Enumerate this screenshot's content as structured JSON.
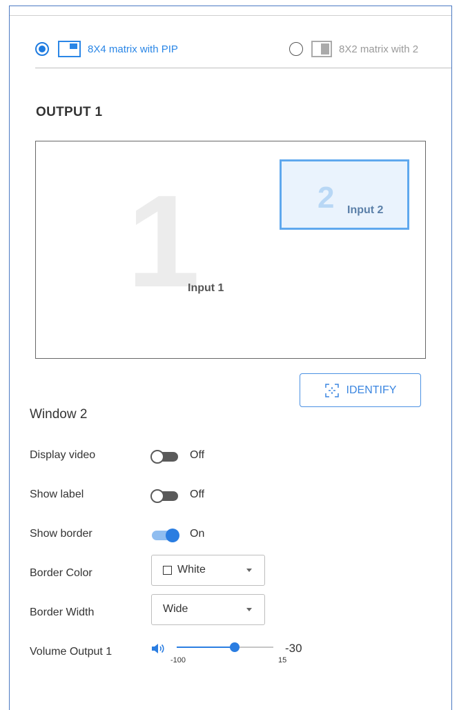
{
  "mode_options": [
    {
      "label": "8X4 matrix with PIP",
      "selected": true
    },
    {
      "label": "8X2 matrix with 2",
      "selected": false
    }
  ],
  "output": {
    "title": "OUTPUT 1",
    "main_window": {
      "number": "1",
      "label": "Input 1"
    },
    "pip_window": {
      "number": "2",
      "label": "Input 2"
    }
  },
  "identify_label": "IDENTIFY",
  "window_settings": {
    "title": "Window 2",
    "display_video": {
      "label": "Display video",
      "state": "Off"
    },
    "show_label": {
      "label": "Show label",
      "state": "Off"
    },
    "show_border": {
      "label": "Show border",
      "state": "On"
    },
    "border_color": {
      "label": "Border Color",
      "value": "White",
      "swatch": "#ffffff"
    },
    "border_width": {
      "label": "Border Width",
      "value": "Wide"
    },
    "volume": {
      "label": "Volume Output 1",
      "min": "-100",
      "max": "15",
      "value": "-30",
      "fraction": 0.6
    }
  },
  "colors": {
    "accent": "#2a7de1",
    "frame": "#4a78c2",
    "pip_border": "#5fa8ee"
  }
}
